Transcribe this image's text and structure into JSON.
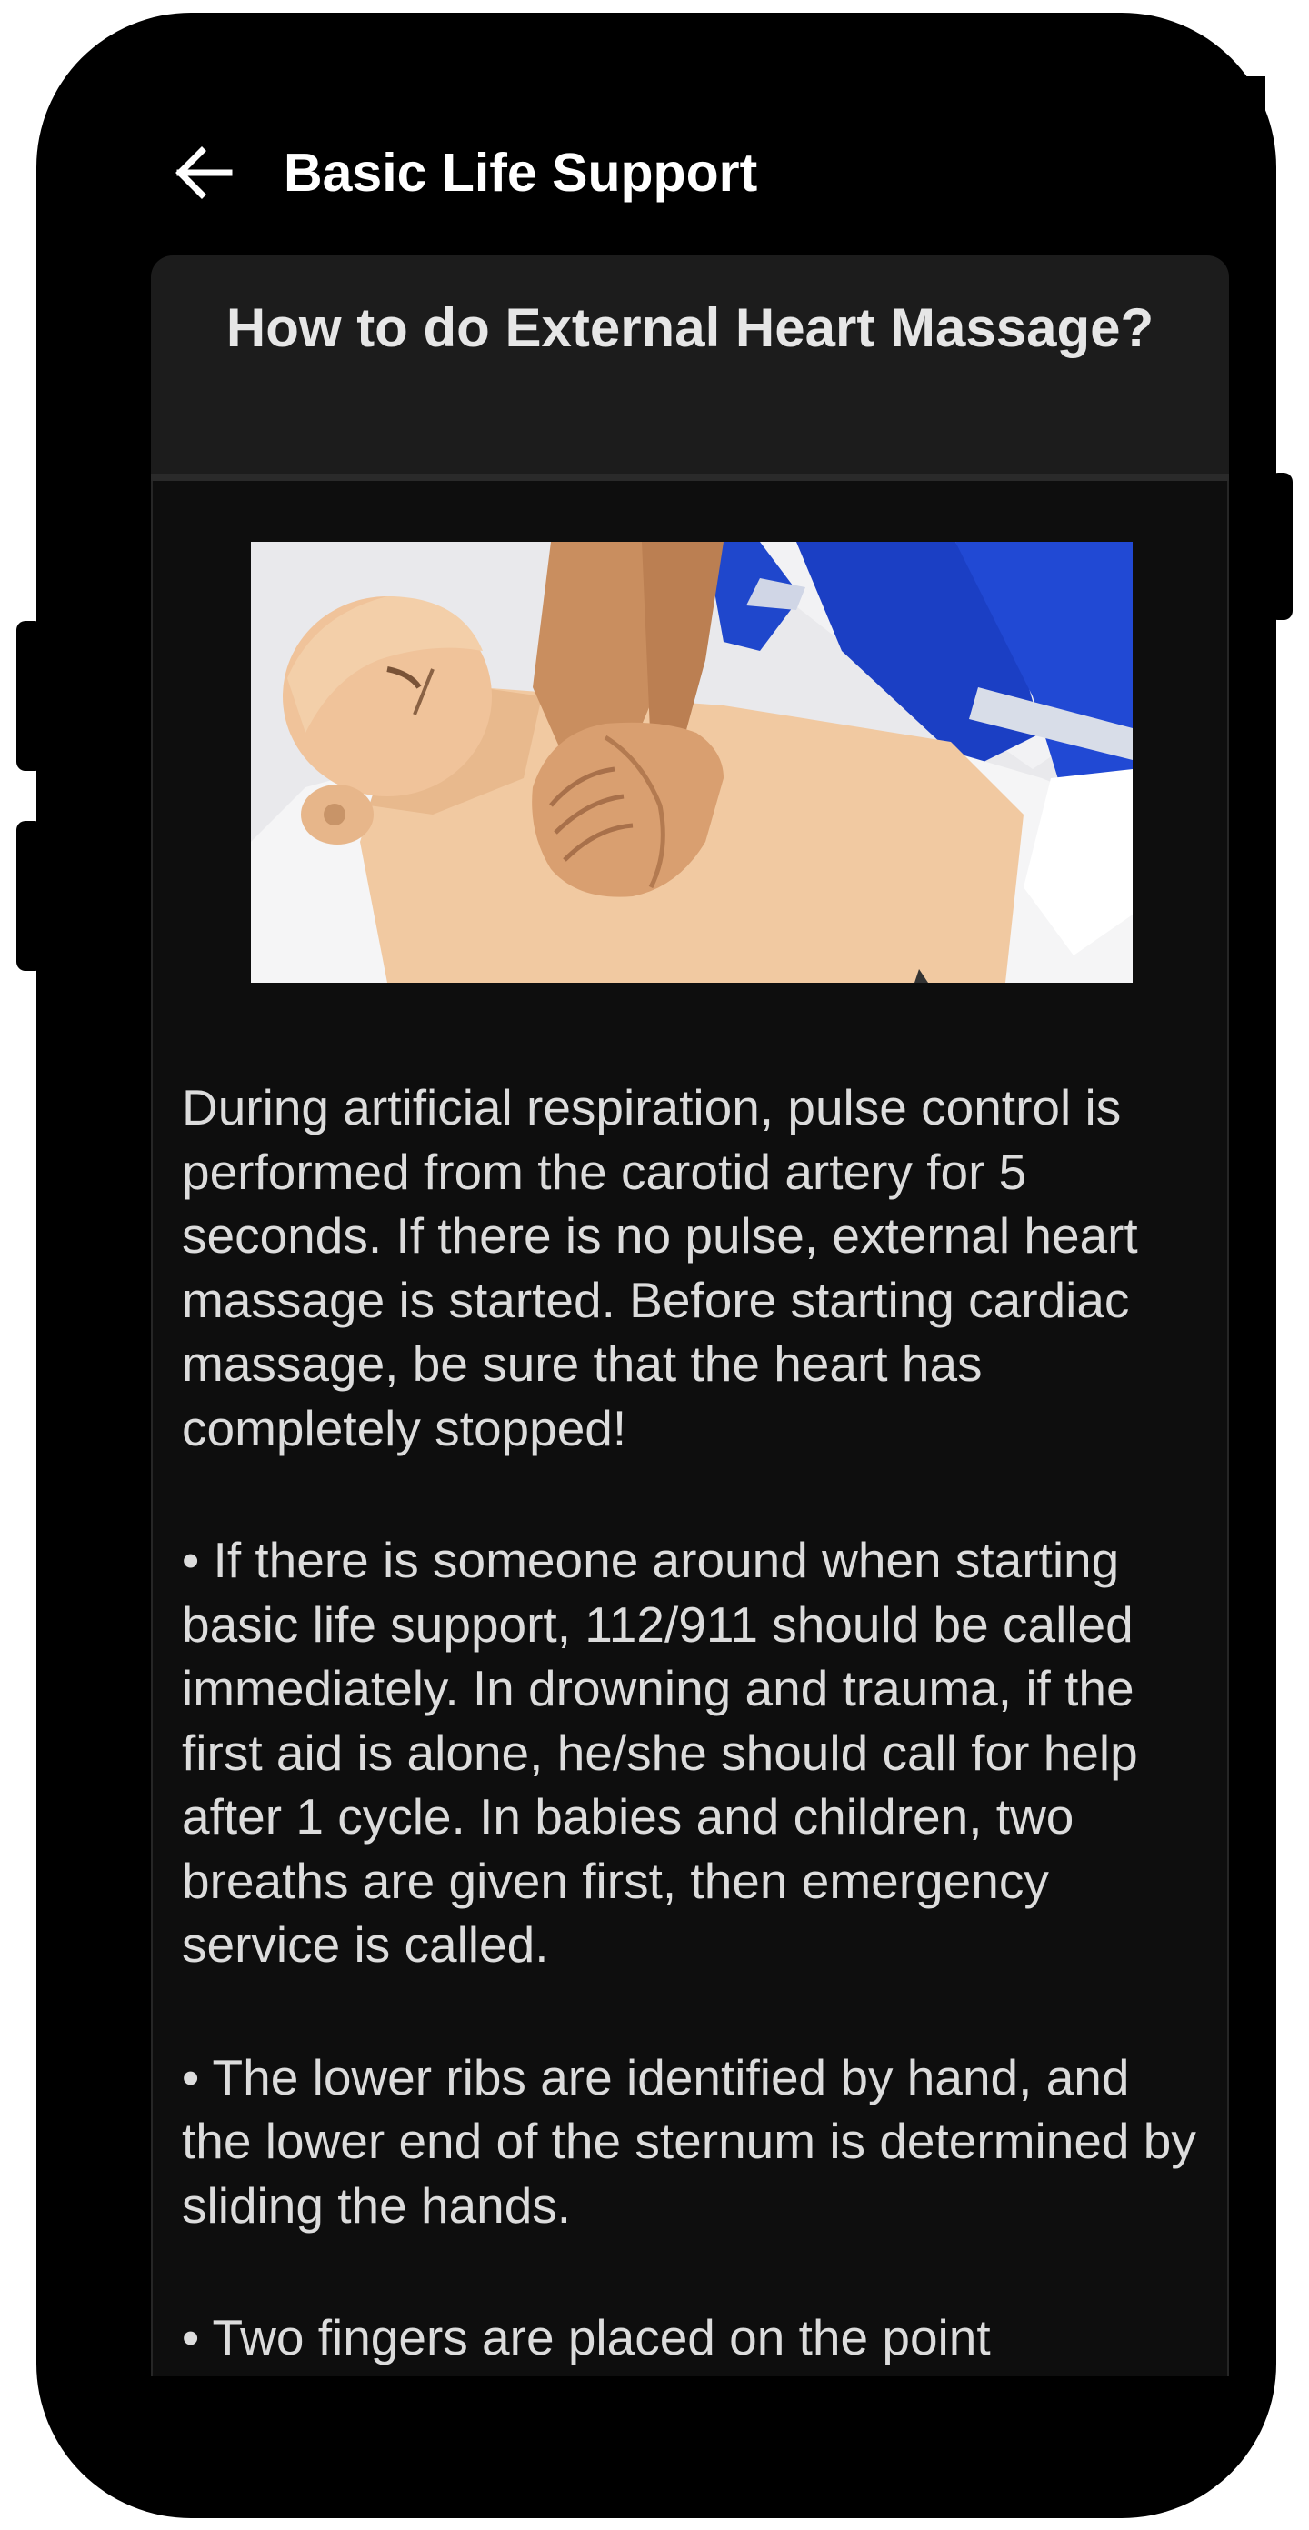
{
  "app_bar": {
    "title": "Basic Life Support",
    "back_icon": "arrow-left-icon"
  },
  "card": {
    "title": "How to do External Heart Massage?",
    "image_alt": "Hands performing chest compressions on a CPR training mannequin",
    "paragraphs": [
      "During artificial respiration, pulse control is performed from the carotid artery for 5 seconds. If there is no pulse, external heart massage is started. Before starting cardiac massage, be sure that the heart has completely stopped!",
      "• If there is someone around when starting basic life support, 112/911 should be called immediately. In drowning and trauma, if the first aid is alone, he/she should call for help after 1 cycle. In babies and children, two breaths are given first, then emergency service is called.",
      "• The lower ribs are identified by hand, and the lower end of the sternum is determined by sliding the hands.",
      "• Two fingers are placed on the point"
    ]
  },
  "nav_bar": {
    "back_icon": "nav-back-triangle-icon",
    "home_icon": "nav-home-circle-icon",
    "recents_icon": "nav-recents-square-icon"
  },
  "colors": {
    "background": "#000000",
    "card": "#0e0e0e",
    "card_header": "#1c1c1c",
    "text": "#dcdcdc",
    "title": "#ffffff"
  }
}
